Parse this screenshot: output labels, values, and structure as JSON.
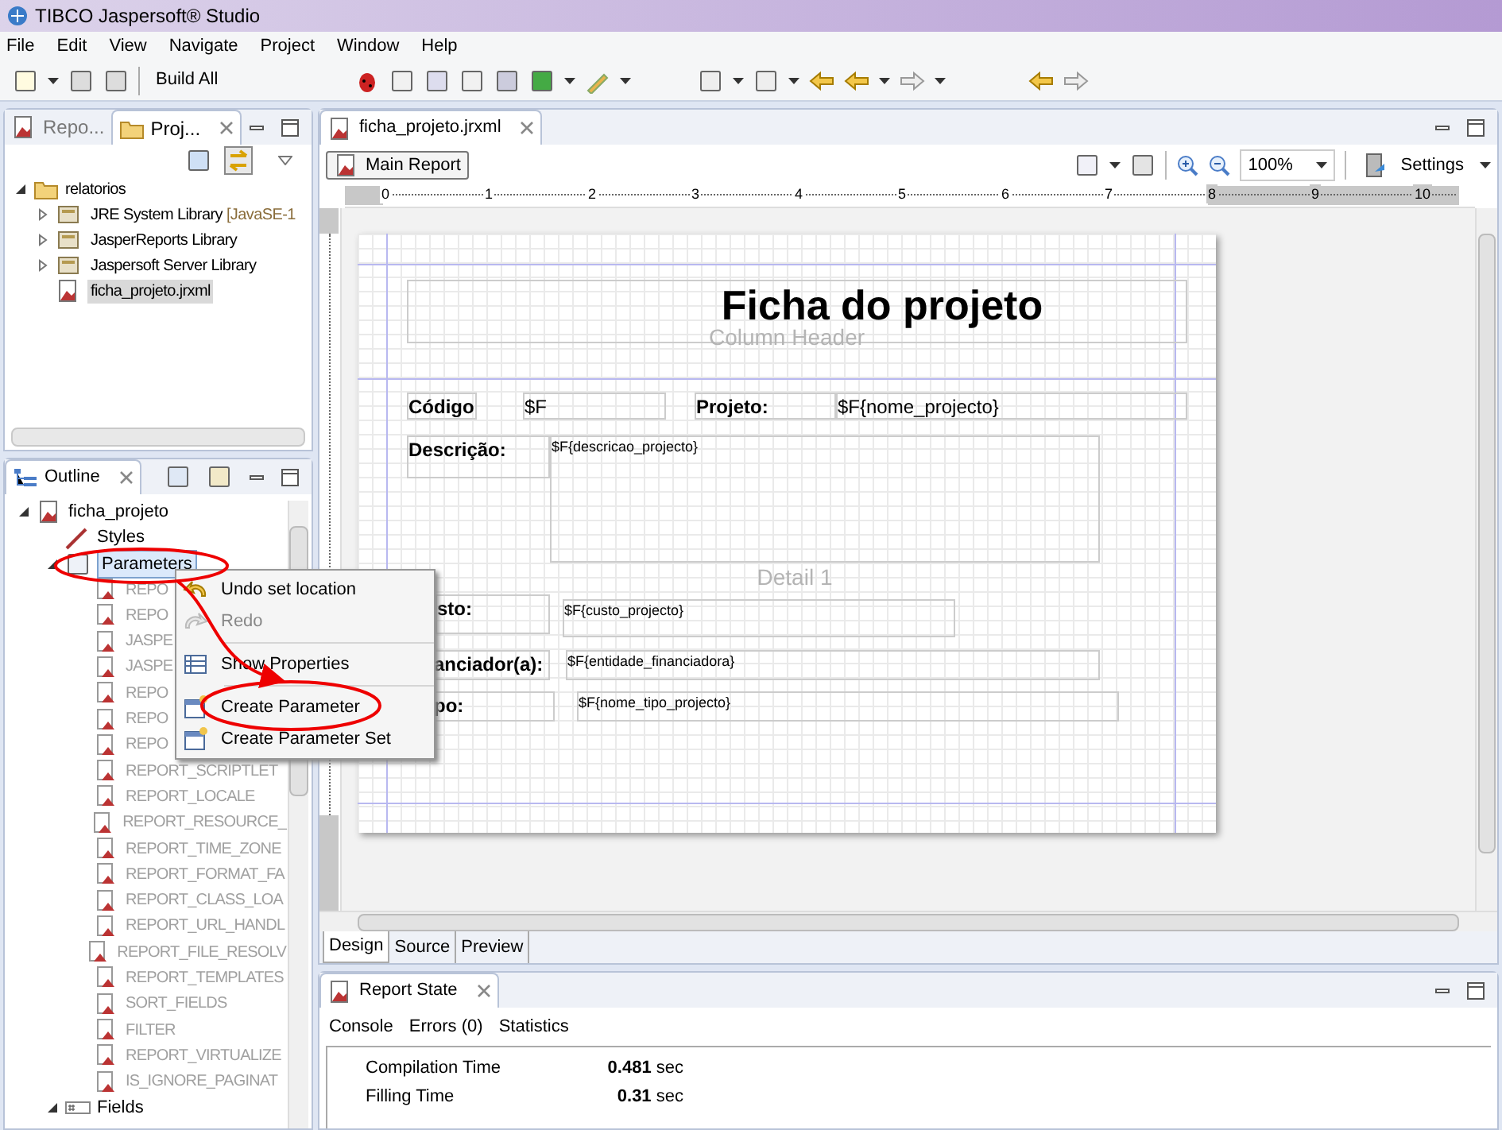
{
  "window": {
    "title": "TIBCO Jaspersoft® Studio"
  },
  "menu_bar": [
    "File",
    "Edit",
    "View",
    "Navigate",
    "Project",
    "Window",
    "Help"
  ],
  "toolbar": {
    "build_all": "Build All"
  },
  "project_panel": {
    "tabs": [
      {
        "label": "Repo...",
        "selected": false
      },
      {
        "label": "Proj...",
        "selected": true
      }
    ],
    "tree": [
      {
        "label": "relatorios",
        "expanded": true,
        "children": [
          {
            "label": "JRE System Library",
            "suffix": "[JavaSE-1",
            "expanded": false,
            "selected": false
          },
          {
            "label": "JasperReports Library",
            "expanded": false,
            "selected": false
          },
          {
            "label": "Jaspersoft Server Library",
            "expanded": false,
            "selected": false
          },
          {
            "label": "ficha_projeto.jrxml",
            "selected": true
          }
        ]
      }
    ]
  },
  "outline_panel": {
    "tab": "Outline",
    "root": "ficha_projeto",
    "styles": "Styles",
    "parameters": {
      "label": "Parameters",
      "selected": true,
      "expanded": true,
      "children": [
        "REPO",
        "REPO",
        "JASPE",
        "JASPE",
        "REPO",
        "REPO",
        "REPO",
        "REPORT_SCRIPTLET",
        "REPORT_LOCALE",
        "REPORT_RESOURCE_",
        "REPORT_TIME_ZONE",
        "REPORT_FORMAT_FA",
        "REPORT_CLASS_LOA",
        "REPORT_URL_HANDL",
        "REPORT_FILE_RESOLV",
        "REPORT_TEMPLATES",
        "SORT_FIELDS",
        "FILTER",
        "REPORT_VIRTUALIZE",
        "IS_IGNORE_PAGINAT"
      ]
    },
    "fields": {
      "label": "Fields",
      "expanded": true
    }
  },
  "editor": {
    "tab": "ficha_projeto.jrxml",
    "main_report": "Main Report",
    "zoom": "100%",
    "settings": "Settings",
    "ruler": [
      "0",
      "1",
      "2",
      "3",
      "4",
      "5",
      "6",
      "7",
      "8",
      "9",
      "10"
    ],
    "report": [
      {
        "kind": "title",
        "text": "Ficha do projeto"
      },
      {
        "kind": "band",
        "text": "Column Header"
      },
      {
        "kind": "label",
        "text": "Código"
      },
      {
        "kind": "field",
        "text": "$F"
      },
      {
        "kind": "label",
        "text": "Projeto:"
      },
      {
        "kind": "field",
        "text": "$F{nome_projecto}"
      },
      {
        "kind": "label",
        "text": "Descrição:"
      },
      {
        "kind": "small",
        "text": "$F{descricao_projecto}"
      },
      {
        "kind": "band",
        "text": "Detail 1"
      },
      {
        "kind": "label",
        "text": "sto:"
      },
      {
        "kind": "small",
        "text": "$F{custo_projecto}"
      },
      {
        "kind": "label",
        "text": "anciador(a):"
      },
      {
        "kind": "small",
        "text": "$F{entidade_financiadora}"
      },
      {
        "kind": "label",
        "text": "po:"
      },
      {
        "kind": "small",
        "text": "$F{nome_tipo_projecto}"
      }
    ],
    "bottom_tabs": [
      {
        "label": "Design",
        "selected": true
      },
      {
        "label": "Source",
        "selected": false
      },
      {
        "label": "Preview",
        "selected": false
      }
    ]
  },
  "context_menu": [
    {
      "label": "Undo set location",
      "disabled": false
    },
    {
      "label": "Redo",
      "disabled": true
    },
    {
      "kind": "separator"
    },
    {
      "label": "Show Properties",
      "disabled": false
    },
    {
      "kind": "separator"
    },
    {
      "label": "Create Parameter",
      "disabled": false
    },
    {
      "label": "Create Parameter Set",
      "disabled": false
    }
  ],
  "report_state": {
    "tab": "Report State",
    "tabs": [
      "Console",
      "Errors (0)",
      "Statistics"
    ],
    "stats": [
      {
        "label": "Compilation Time",
        "value": "0.481",
        "unit": "sec"
      },
      {
        "label": "Filling Time",
        "value": "0.31",
        "unit": "sec"
      }
    ]
  }
}
